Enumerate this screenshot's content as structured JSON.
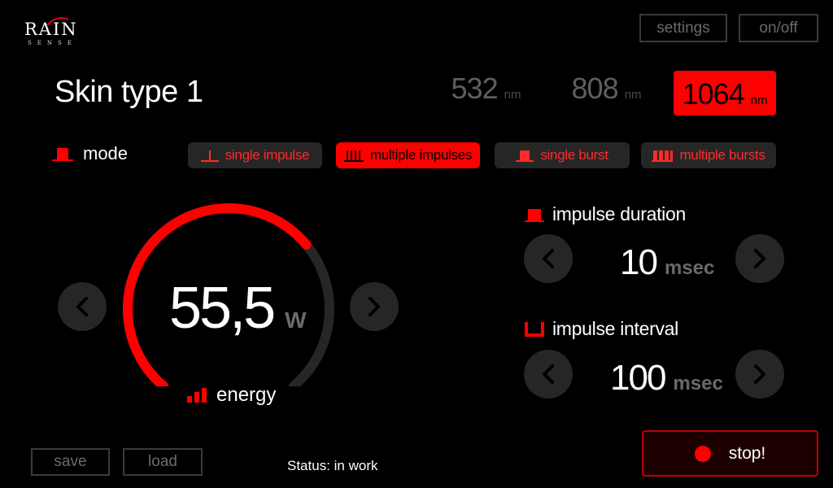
{
  "logo": {
    "main": "RAIN",
    "sub": "SENSE"
  },
  "header": {
    "settings_label": "settings",
    "onoff_label": "on/off"
  },
  "title": "Skin type 1",
  "wavelengths": [
    {
      "value": "532",
      "unit": "nm",
      "selected": false
    },
    {
      "value": "808",
      "unit": "nm",
      "selected": false
    },
    {
      "value": "1064",
      "unit": "nm",
      "selected": true
    }
  ],
  "mode": {
    "label": "mode",
    "options": [
      {
        "label": "single impulse",
        "icon": "single-impulse-icon",
        "selected": false
      },
      {
        "label": "multiple impulses",
        "icon": "multiple-impulses-icon",
        "selected": true
      },
      {
        "label": "single burst",
        "icon": "single-burst-icon",
        "selected": false
      },
      {
        "label": "multiple bursts",
        "icon": "multiple-bursts-icon",
        "selected": false
      }
    ]
  },
  "energy": {
    "value": "55,5",
    "unit": "W",
    "label": "energy",
    "gauge_level": 0.68
  },
  "impulse_duration": {
    "label": "impulse duration",
    "value": "10",
    "unit": "msec"
  },
  "impulse_interval": {
    "label": "impulse interval",
    "value": "100",
    "unit": "msec"
  },
  "footer": {
    "save_label": "save",
    "load_label": "load",
    "status": "Status: in work",
    "stop_label": "stop!"
  },
  "colors": {
    "accent": "#ff0000",
    "background": "#000000",
    "button_bg": "#262626",
    "track": "#262626",
    "muted": "#5e5e5e"
  }
}
